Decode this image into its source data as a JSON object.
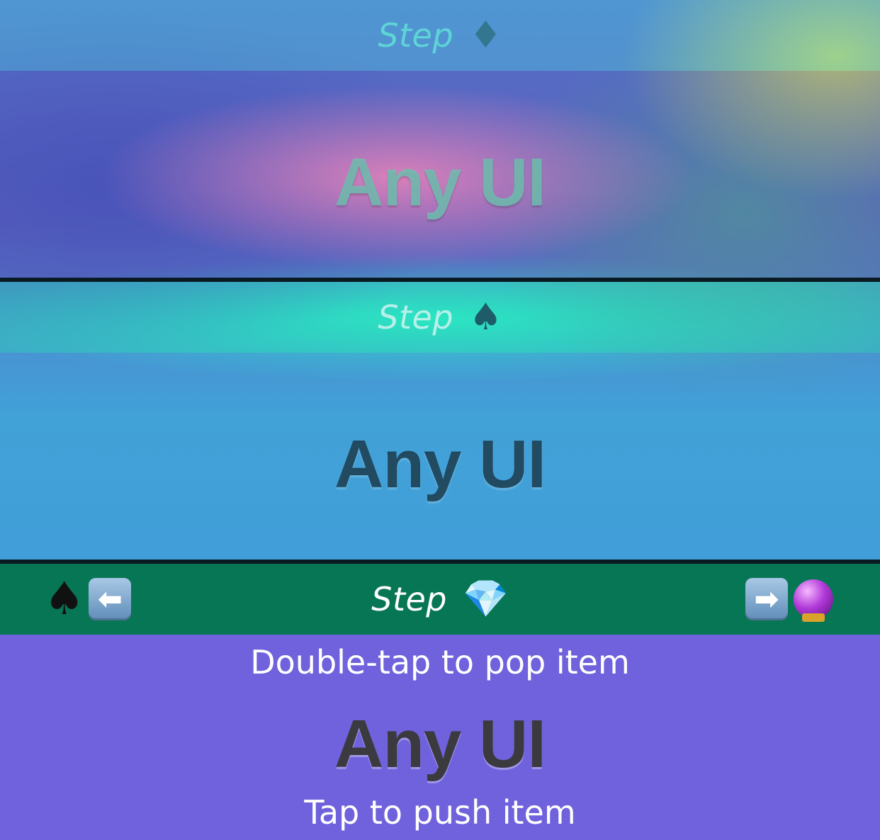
{
  "cards": [
    {
      "nav_title": "Step",
      "nav_icon": "♦",
      "body_text": "Any UI"
    },
    {
      "nav_title": "Step",
      "nav_icon": "♠",
      "body_text": "Any UI"
    },
    {
      "nav_title": "Step",
      "nav_icon": "💎",
      "body_text": "Any UI",
      "hint_top": "Double-tap to pop item",
      "hint_bottom": "Tap to push item",
      "left_buttons": {
        "spade": "♠",
        "arrow": "⬅"
      },
      "right_buttons": {
        "arrow": "➡",
        "orb": "crystal-ball-icon"
      }
    }
  ],
  "colors": {
    "front_navbar": "#077654",
    "front_body": "#6f62dc",
    "divider": "#0a1a22"
  }
}
